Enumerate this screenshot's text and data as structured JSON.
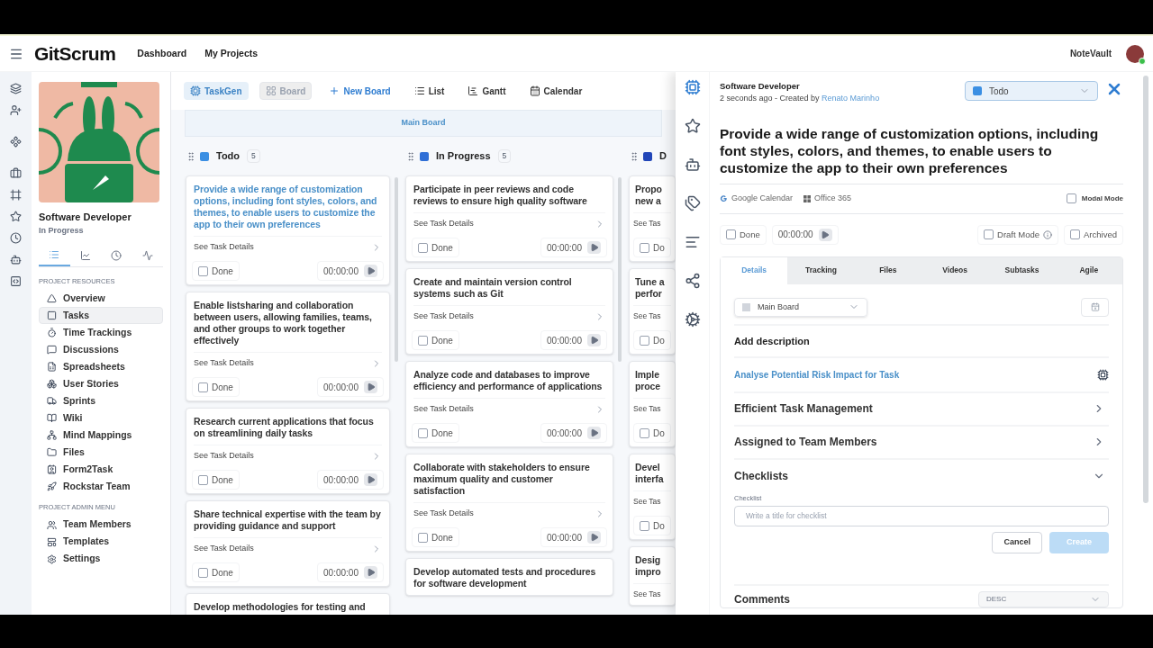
{
  "header": {
    "logo": "GitScrum",
    "nav": [
      {
        "label": "Dashboard"
      },
      {
        "label": "My Projects"
      }
    ],
    "workspace": "NoteVault",
    "user_online": true
  },
  "project": {
    "name": "Software Developer",
    "status": "In Progress",
    "tabs": [
      {
        "selected": true
      },
      {
        "selected": false
      },
      {
        "selected": false
      },
      {
        "selected": false
      }
    ]
  },
  "menus": [
    {
      "title": "PROJECT RESOURCES",
      "items": [
        {
          "label": "Overview",
          "selected": false
        },
        {
          "label": "Tasks",
          "selected": true
        },
        {
          "label": "Time Trackings",
          "selected": false
        },
        {
          "label": "Discussions",
          "selected": false
        },
        {
          "label": "Spreadsheets",
          "selected": false
        },
        {
          "label": "User Stories",
          "selected": false
        },
        {
          "label": "Sprints",
          "selected": false
        },
        {
          "label": "Wiki",
          "selected": false
        },
        {
          "label": "Mind Mappings",
          "selected": false
        },
        {
          "label": "Files",
          "selected": false
        },
        {
          "label": "Form2Task",
          "selected": false
        },
        {
          "label": "Rockstar Team",
          "selected": false
        }
      ]
    },
    {
      "title": "PROJECT ADMIN MENU",
      "items": [
        {
          "label": "Team Members",
          "selected": false
        },
        {
          "label": "Templates",
          "selected": false
        },
        {
          "label": "Settings",
          "selected": false
        }
      ]
    }
  ],
  "toolbar": [
    {
      "label": "TaskGen",
      "kind": "ai",
      "selected": false
    },
    {
      "label": "Board",
      "kind": "board",
      "selected": true
    },
    {
      "label": "New Board",
      "kind": "add",
      "selected": false
    },
    {
      "label": "List",
      "kind": "list",
      "selected": false
    },
    {
      "label": "Gantt",
      "kind": "gantt",
      "selected": false
    },
    {
      "label": "Calendar",
      "kind": "calendar",
      "selected": false
    }
  ],
  "board_title": "Main Board",
  "columns": [
    {
      "name": "Todo",
      "count": "5",
      "color": "#3b8fe3",
      "cards": [
        {
          "title": "Provide a wide range of customization options, including font styles, colors, and themes, to enable users to customize the app to their own preferences",
          "highlighted": true,
          "details": "See Task Details",
          "done_label": "Done",
          "done": false,
          "timer": "00:00:00"
        },
        {
          "title": "Enable listsharing and collaboration between users, allowing families, teams, and other groups to work together effectively",
          "highlighted": false,
          "details": "See Task Details",
          "done_label": "Done",
          "done": false,
          "timer": "00:00:00"
        },
        {
          "title": "Research current applications that focus on streamlining daily tasks",
          "highlighted": false,
          "details": "See Task Details",
          "done_label": "Done",
          "done": false,
          "timer": "00:00:00"
        },
        {
          "title": "Share technical expertise with the team by providing guidance and support",
          "highlighted": false,
          "details": "See Task Details",
          "done_label": "Done",
          "done": false,
          "timer": "00:00:00"
        },
        {
          "title": "Develop methodologies for testing and",
          "highlighted": false
        }
      ]
    },
    {
      "name": "In Progress",
      "count": "5",
      "color": "#2f6fd6",
      "cards": [
        {
          "title": "Participate in peer reviews and code reviews to ensure high quality software",
          "highlighted": false,
          "details": "See Task Details",
          "done_label": "Done",
          "done": false,
          "timer": "00:00:00"
        },
        {
          "title": "Create and maintain version control systems such as Git",
          "highlighted": false,
          "details": "See Task Details",
          "done_label": "Done",
          "done": false,
          "timer": "00:00:00"
        },
        {
          "title": "Analyze code and databases to improve efficiency and performance of applications",
          "highlighted": false,
          "details": "See Task Details",
          "done_label": "Done",
          "done": false,
          "timer": "00:00:00"
        },
        {
          "title": "Collaborate with stakeholders to ensure maximum quality and customer satisfaction",
          "highlighted": false,
          "details": "See Task Details",
          "done_label": "Done",
          "done": false,
          "timer": "00:00:00"
        },
        {
          "title": "Develop automated tests and procedures for software development",
          "highlighted": false
        }
      ]
    },
    {
      "name": "D",
      "color": "#2146b8",
      "cards": [
        {
          "title": "Propo\nnew a",
          "highlighted": false,
          "details": "See Tas",
          "done_label": "Do",
          "done": false
        },
        {
          "title": "Tune a\nperfor",
          "highlighted": false,
          "details": "See Tas",
          "done_label": "Do",
          "done": false
        },
        {
          "title": "Imple\nproce",
          "highlighted": false,
          "details": "See Tas",
          "done_label": "Do",
          "done": false
        },
        {
          "title": "Devel\ninterfa",
          "highlighted": false,
          "details": "See Tas",
          "done_label": "Do",
          "done": false
        },
        {
          "title": "Desig\nimpro",
          "highlighted": false,
          "details": "See Tas"
        }
      ]
    }
  ],
  "panel": {
    "project": "Software Developer",
    "meta": "2 seconds ago - Created by",
    "author": "Renato Marinho",
    "status": {
      "label": "Todo",
      "color": "#3b8fe3"
    },
    "title": "Provide a wide range of customization options, including font styles, colors, and themes, to enable users to customize the app to their own preferences",
    "integrations": [
      "Google Calendar",
      "Office 365"
    ],
    "modal_mode": {
      "label": "Modal Mode",
      "checked": false
    },
    "done": {
      "label": "Done",
      "checked": false
    },
    "timer": "00:00:00",
    "draft": {
      "label": "Draft Mode",
      "checked": false
    },
    "archived": {
      "label": "Archived",
      "checked": false
    },
    "tabs": [
      {
        "label": "Details",
        "selected": true
      },
      {
        "label": "Tracking",
        "selected": false
      },
      {
        "label": "Files",
        "selected": false
      },
      {
        "label": "Videos",
        "selected": false
      },
      {
        "label": "Subtasks",
        "selected": false
      },
      {
        "label": "Agile",
        "selected": false
      }
    ],
    "board_select": "Main Board",
    "add_description": "Add description",
    "ai_action": "Analyse Potential Risk Impact for Task",
    "sections": [
      {
        "label": "Efficient Task Management",
        "expanded": false
      },
      {
        "label": "Assigned to Team Members",
        "expanded": false
      },
      {
        "label": "Checklists",
        "expanded": true
      }
    ],
    "checklist": {
      "label": "Checklist",
      "placeholder": "Write a title for checklist",
      "cancel": "Cancel",
      "create": "Create",
      "create_disabled": true
    },
    "comments": "Comments",
    "sort": "DESC"
  }
}
